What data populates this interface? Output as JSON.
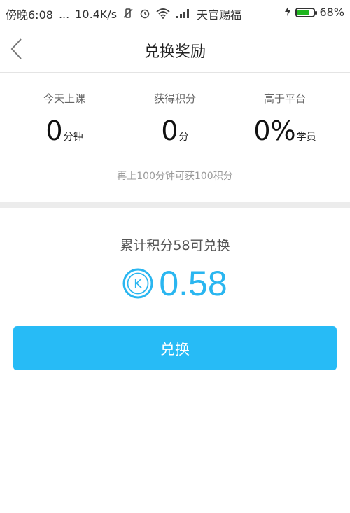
{
  "status_bar": {
    "time": "傍晚6:08",
    "dots": "...",
    "network_speed": "10.4K/s",
    "carrier": "天官赐福",
    "battery_percent": "68%",
    "battery_level": 0.68,
    "icons": [
      "vibrate-off-icon",
      "alarm-icon",
      "wifi-icon",
      "signal-icon",
      "charging-icon",
      "battery-icon"
    ]
  },
  "header": {
    "title": "兑换奖励",
    "back_icon": "chevron-left-icon"
  },
  "stats": [
    {
      "label": "今天上课",
      "value": "0",
      "unit": "分钟"
    },
    {
      "label": "获得积分",
      "value": "0",
      "unit": "分"
    },
    {
      "label": "高于平台",
      "value": "0%",
      "unit": "学员"
    }
  ],
  "hint": "再上100分钟可获100积分",
  "exchange": {
    "summary": "累计积分58可兑换",
    "coin_icon": "k-coin-icon",
    "coin_letter": "K",
    "amount": "0.58",
    "button_label": "兑换",
    "accent_color": "#27bbf6"
  }
}
